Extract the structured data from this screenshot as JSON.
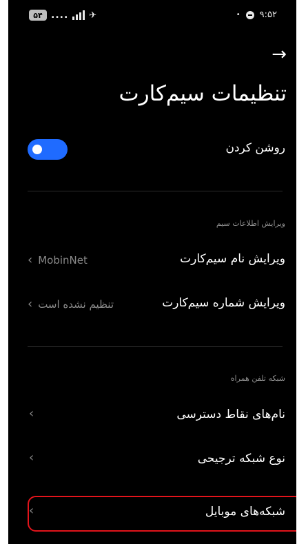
{
  "status_bar": {
    "battery": "۵۴",
    "dots": "....",
    "time": "۹:۵۲"
  },
  "header": {
    "back_icon": "arrow-right-icon",
    "title": "تنظیمات سیم‌کارت"
  },
  "toggle_row": {
    "label": "روشن کردن",
    "enabled": true,
    "accent_color": "#1f6bff"
  },
  "sections": [
    {
      "title": "ویرایش اطلاعات سیم",
      "items": [
        {
          "label": "ویرایش نام سیم‌کارت",
          "value": "MobinNet"
        },
        {
          "label": "ویرایش شماره سیم‌کارت",
          "value": "تنظیم نشده است"
        }
      ]
    },
    {
      "title": "شبکه تلفن همراه",
      "items": [
        {
          "label": "نام‌های نقاط دسترسی"
        },
        {
          "label": "نوع شبکه ترجیحی"
        },
        {
          "label": "شبکه‌های موبایل",
          "highlighted": true,
          "highlight_color": "#e3141b"
        }
      ]
    }
  ]
}
